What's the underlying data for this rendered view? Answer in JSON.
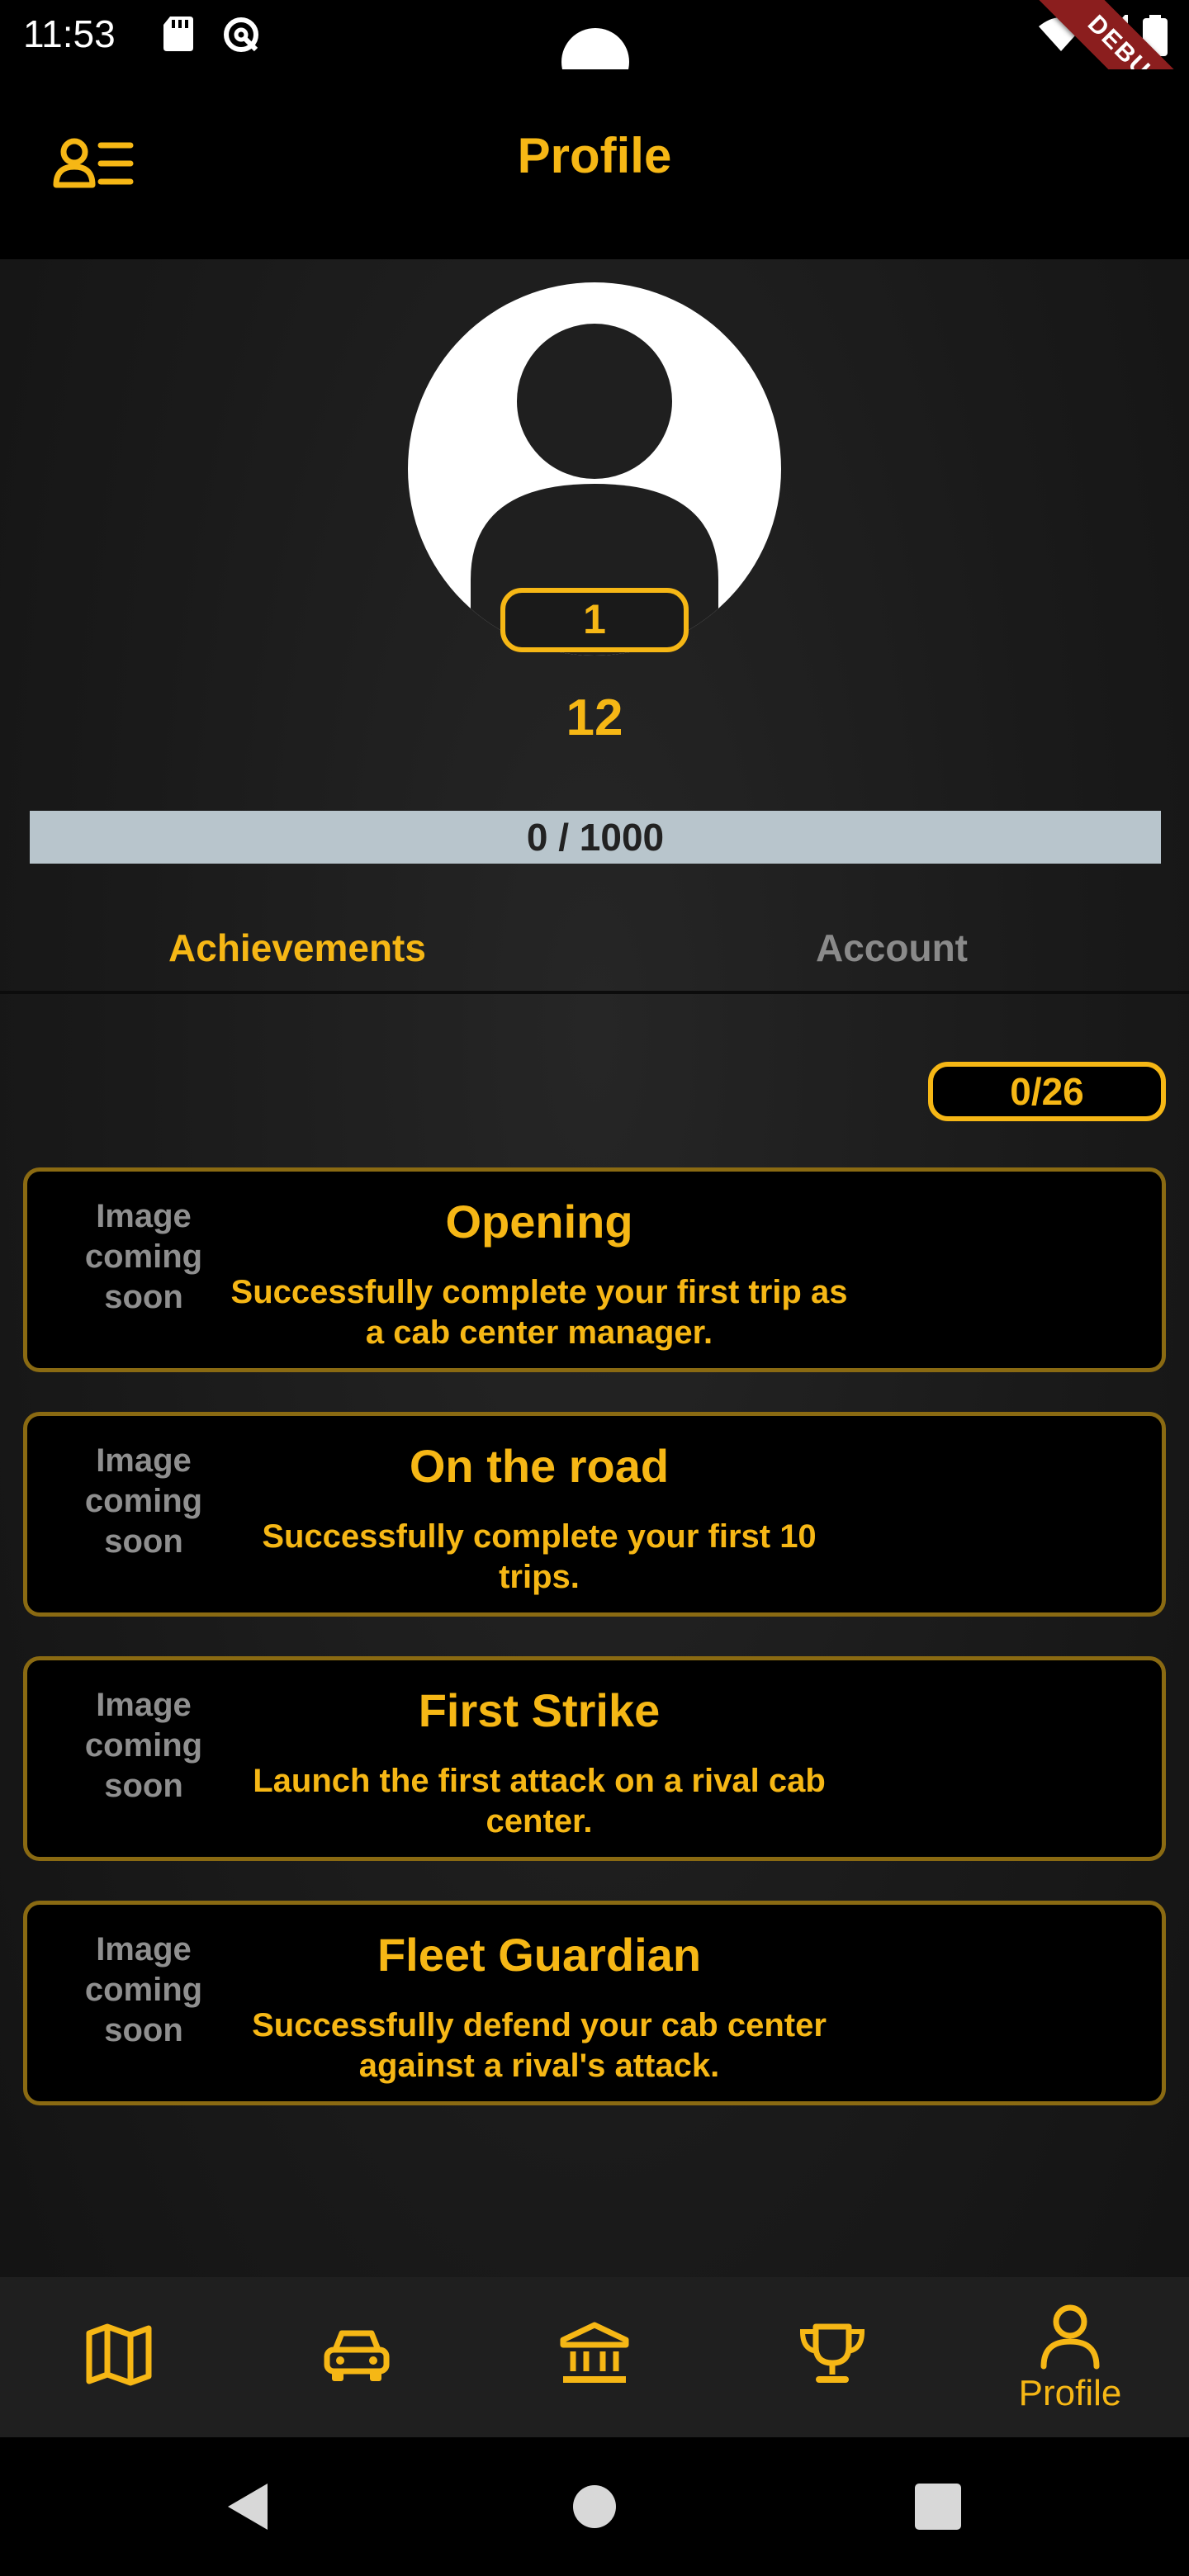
{
  "status_bar": {
    "time": "11:53",
    "debug_label": "DEBUG"
  },
  "header": {
    "title": "Profile",
    "menu_icon": "profile-menu-icon"
  },
  "profile": {
    "level_badge": "1",
    "level_number": "12",
    "xp": {
      "current": 0,
      "max": 1000,
      "label": "0 / 1000"
    }
  },
  "tabs": [
    {
      "label": "Achievements",
      "active": true
    },
    {
      "label": "Account",
      "active": false
    }
  ],
  "achievements": {
    "counter": "0/26",
    "items": [
      {
        "image_placeholder": [
          "Image",
          "coming",
          "soon"
        ],
        "title": "Opening",
        "description": "Successfully complete your first trip as a cab center manager."
      },
      {
        "image_placeholder": [
          "Image",
          "coming",
          "soon"
        ],
        "title": "On the road",
        "description": "Successfully complete your first 10 trips."
      },
      {
        "image_placeholder": [
          "Image",
          "coming",
          "soon"
        ],
        "title": "First Strike",
        "description": "Launch the first attack on a rival cab center."
      },
      {
        "image_placeholder": [
          "Image",
          "coming",
          "soon"
        ],
        "title": "Fleet Guardian",
        "description": "Successfully defend your cab center against a rival's attack."
      }
    ]
  },
  "bottom_nav": [
    {
      "icon": "map-icon",
      "label": ""
    },
    {
      "icon": "car-icon",
      "label": ""
    },
    {
      "icon": "bank-icon",
      "label": ""
    },
    {
      "icon": "trophy-icon",
      "label": ""
    },
    {
      "icon": "profile-icon",
      "label": "Profile",
      "active": true
    }
  ],
  "colors": {
    "accent": "#f6b715",
    "card_border": "#8a6a12",
    "inactive_text": "#8a8a8a",
    "xp_track": "#b8c5cc"
  }
}
